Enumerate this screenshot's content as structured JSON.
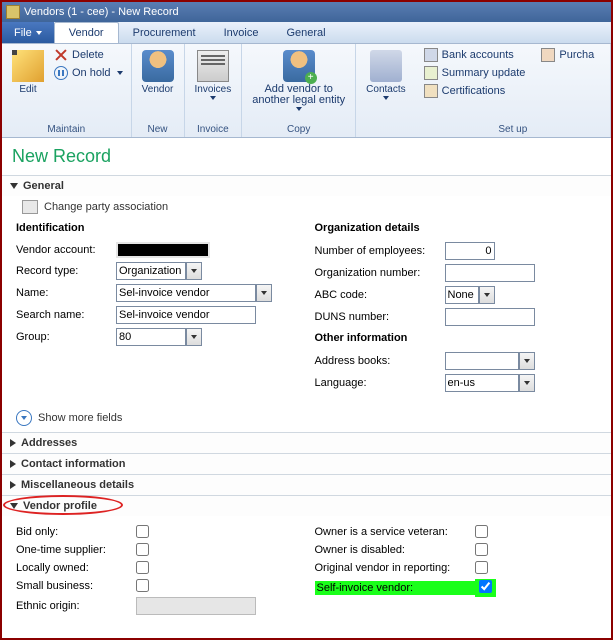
{
  "window_title": "Vendors (1 - cee) - New Record",
  "file_menu": "File",
  "tabs": {
    "vendor": "Vendor",
    "procurement": "Procurement",
    "invoice": "Invoice",
    "general": "General"
  },
  "ribbon": {
    "edit": "Edit",
    "delete": "Delete",
    "on_hold": "On hold",
    "maintain": "Maintain",
    "vendor": "Vendor",
    "new": "New",
    "invoices": "Invoices",
    "invoice": "Invoice",
    "add_vendor_line1": "Add vendor to",
    "add_vendor_line2": "another legal entity",
    "copy": "Copy",
    "contacts": "Contacts",
    "bank": "Bank accounts",
    "summary": "Summary update",
    "cert": "Certifications",
    "setup": "Set up",
    "purch": "Purcha"
  },
  "page_title": "New Record",
  "sections": {
    "general": "General",
    "change_party": "Change party association",
    "identification": "Identification",
    "vendor_account": "Vendor account:",
    "record_type": "Record type:",
    "record_type_val": "Organization",
    "name": "Name:",
    "name_val": "Sel-invoice vendor",
    "search_name": "Search name:",
    "search_name_val": "Sel-invoice vendor",
    "group": "Group:",
    "group_val": "80",
    "org_details": "Organization details",
    "num_emp": "Number of employees:",
    "num_emp_val": "0",
    "org_num": "Organization number:",
    "org_num_val": "",
    "abc": "ABC code:",
    "abc_val": "None",
    "duns": "DUNS number:",
    "duns_val": "",
    "other_info": "Other information",
    "addr_books": "Address books:",
    "addr_books_val": "",
    "language": "Language:",
    "language_val": "en-us",
    "show_more": "Show more fields",
    "addresses": "Addresses",
    "contact_info": "Contact information",
    "misc": "Miscellaneous details",
    "vendor_profile": "Vendor profile"
  },
  "vp": {
    "bid_only": "Bid only:",
    "one_time": "One-time supplier:",
    "locally": "Locally owned:",
    "small_biz": "Small business:",
    "ethnic": "Ethnic origin:",
    "veteran": "Owner is a service veteran:",
    "disabled": "Owner is disabled:",
    "orig": "Original vendor in reporting:",
    "self_inv": "Self-invoice vendor:"
  }
}
